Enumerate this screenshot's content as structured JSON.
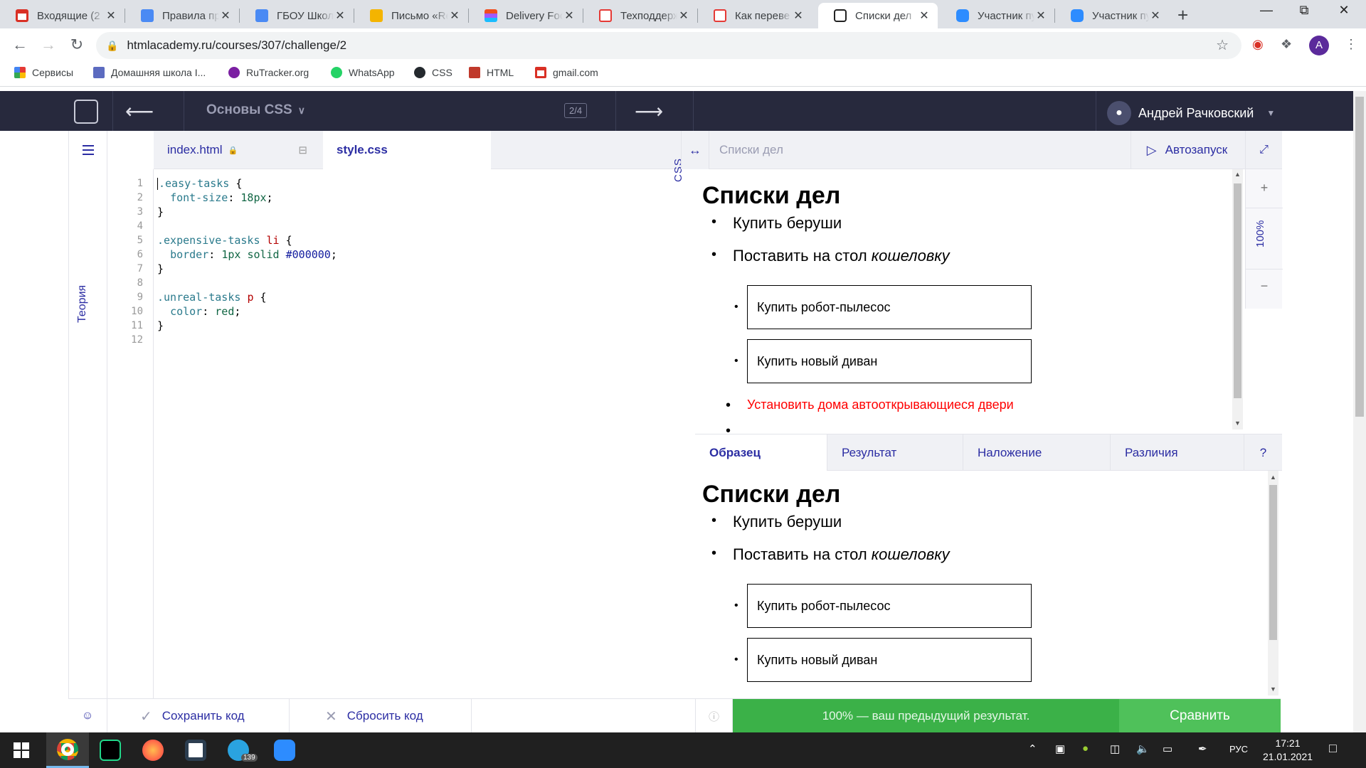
{
  "browser": {
    "tabs": [
      {
        "title": "Входящие (2",
        "color": "#d93025"
      },
      {
        "title": "Правила пр",
        "color": "#4a8af4"
      },
      {
        "title": "ГБОУ Школа",
        "color": "#4a8af4"
      },
      {
        "title": "Письмо «Re",
        "color": "#f4b400"
      },
      {
        "title": "Delivery Foo",
        "color": "#a259ff"
      },
      {
        "title": "Техподдерж",
        "color": "#e53935"
      },
      {
        "title": "Как переве",
        "color": "#e53935"
      },
      {
        "title": "Списки дел",
        "color": "#222222"
      },
      {
        "title": "Участник пу",
        "color": "#2d8cff"
      },
      {
        "title": "Участник пу",
        "color": "#2d8cff"
      }
    ],
    "active_tab_index": 7,
    "close_glyph": "✕",
    "new_tab_glyph": "+",
    "url": "htmlacademy.ru/courses/307/challenge/2",
    "profile_initial": "A",
    "bookmarks": [
      {
        "label": "Сервисы",
        "color": "#e53935"
      },
      {
        "label": "Домашняя школа I...",
        "color": "#5c6bc0"
      },
      {
        "label": "RuTracker.org",
        "color": "#7b1fa2"
      },
      {
        "label": "WhatsApp",
        "color": "#25d366"
      },
      {
        "label": "CSS",
        "color": "#24292e"
      },
      {
        "label": "HTML",
        "color": "#c0392b"
      },
      {
        "label": "gmail.com",
        "color": "#d93025"
      }
    ]
  },
  "app": {
    "course_title": "Основы CSS",
    "progress": "2/4",
    "user_name": "Андрей Рачковский",
    "sidebar_theory_label": "Теория",
    "editor_tabs": [
      {
        "label": "index.html",
        "locked": true
      },
      {
        "label": "style.css",
        "locked": false
      }
    ],
    "active_editor_tab": "style.css",
    "editor_lang_label": "CSS",
    "line_numbers": [
      "1",
      "2",
      "3",
      "4",
      "5",
      "6",
      "7",
      "8",
      "9",
      "10",
      "11",
      "12"
    ],
    "code_lines": [
      ".easy-tasks {",
      "  font-size: 18px;",
      "}",
      "",
      ".expensive-tasks li {",
      "  border: 1px solid #000000;",
      "}",
      "",
      ".unreal-tasks p {",
      "  color: red;",
      "}",
      ""
    ],
    "preview_title": "Списки дел",
    "autorun_label": "Автозапуск",
    "zoom": "100%",
    "zoom_in": "+",
    "zoom_out": "−",
    "preview": {
      "heading": "Списки дел",
      "easy_items": [
        "Купить беруши",
        "Поставить на стол"
      ],
      "easy_italic": "кошеловку",
      "expensive_items": [
        "Купить робот-пылесос",
        "Купить новый диван"
      ],
      "unreal_items": [
        "Установить дома автооткрывающиеся двери"
      ]
    },
    "compare_tabs": [
      "Образец",
      "Результат",
      "Наложение",
      "Различия",
      "?"
    ],
    "active_compare_tab": "Образец",
    "save_label": "Сохранить код",
    "reset_label": "Сбросить код",
    "result_text": "100% — ваш предыдущий результат.",
    "compare_label": "Сравнить",
    "colors": {
      "header_bg": "#27293d",
      "accent": "#2b2da3",
      "success": "#3bb148"
    }
  },
  "taskbar": {
    "apps": [
      "chrome-icon",
      "pycharm-icon",
      "firefox-icon",
      "app-icon",
      "telegram-icon",
      "zoom-icon"
    ],
    "telegram_badge": "139",
    "language": "РУС",
    "time": "17:21",
    "date": "21.01.2021"
  }
}
